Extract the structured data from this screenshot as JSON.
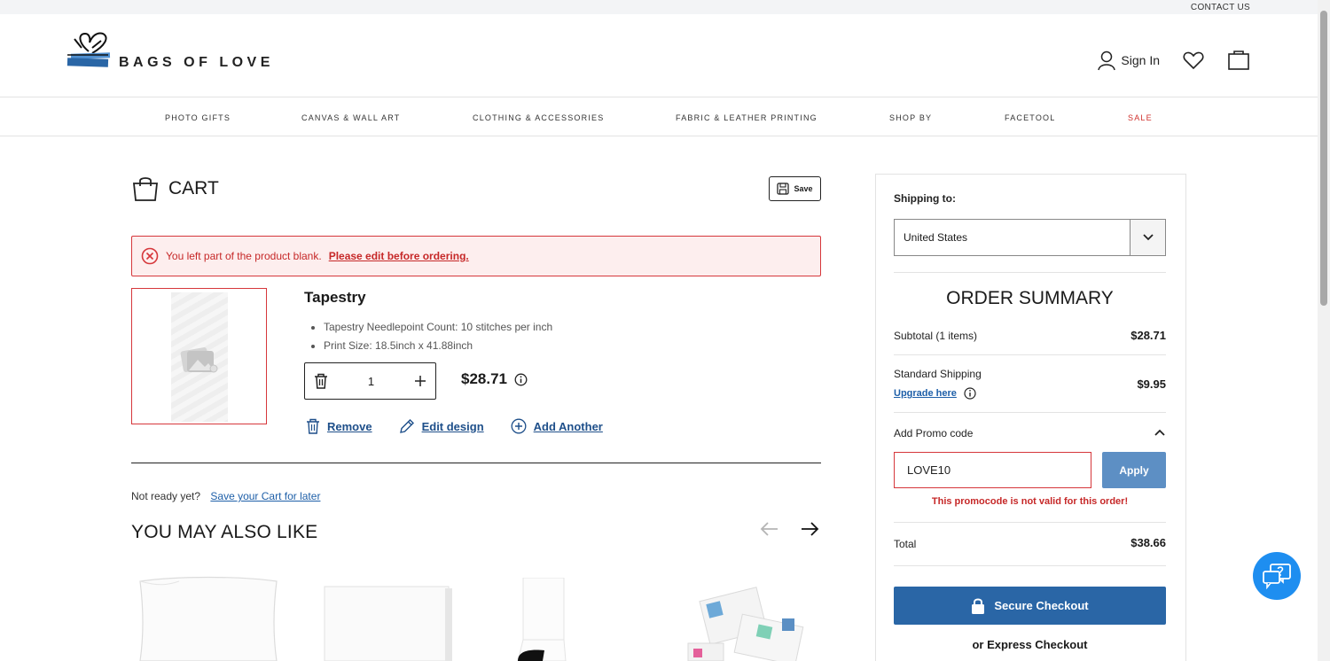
{
  "topbar": {
    "contact": "CONTACT US"
  },
  "header": {
    "logo_text": "BAGS OF LOVE",
    "sign_in": "Sign In"
  },
  "nav": {
    "items": [
      "PHOTO GIFTS",
      "CANVAS & WALL ART",
      "CLOTHING & ACCESSORIES",
      "FABRIC & LEATHER PRINTING",
      "SHOP BY",
      "FACETOOL",
      "SALE"
    ]
  },
  "cart": {
    "title": "CART",
    "save_label": "Save",
    "alert_text": "You left part of the product blank.",
    "alert_link": "Please edit before ordering.",
    "item": {
      "name": "Tapestry",
      "attributes": [
        "Tapestry Needlepoint Count: 10 stitches per inch",
        "Print Size: 18.5inch x 41.88inch"
      ],
      "quantity": "1",
      "price": "$28.71"
    },
    "actions": {
      "remove": "Remove",
      "edit": "Edit design",
      "add_another": "Add Another"
    },
    "not_ready": "Not ready yet?",
    "save_for_later": "Save your Cart for later",
    "recommend_title": "YOU MAY ALSO LIKE"
  },
  "summary": {
    "shipping_to_label": "Shipping to:",
    "country": "United States",
    "title": "ORDER SUMMARY",
    "subtotal_label": "Subtotal (1 items)",
    "subtotal_value": "$28.71",
    "shipping_label": "Standard Shipping",
    "upgrade_label": "Upgrade here",
    "shipping_value": "$9.95",
    "promo_label": "Add Promo code",
    "promo_value": "LOVE10",
    "apply_label": "Apply",
    "promo_error": "This promocode is not valid for this order!",
    "total_label": "Total",
    "total_value": "$38.66",
    "checkout_label": "Secure Checkout",
    "express_label": "or Express Checkout"
  },
  "colors": {
    "accent_blue": "#2a66a6",
    "error_red": "#d6373b",
    "link_blue": "#1e5fa8",
    "chat_blue": "#1e8ef0"
  }
}
